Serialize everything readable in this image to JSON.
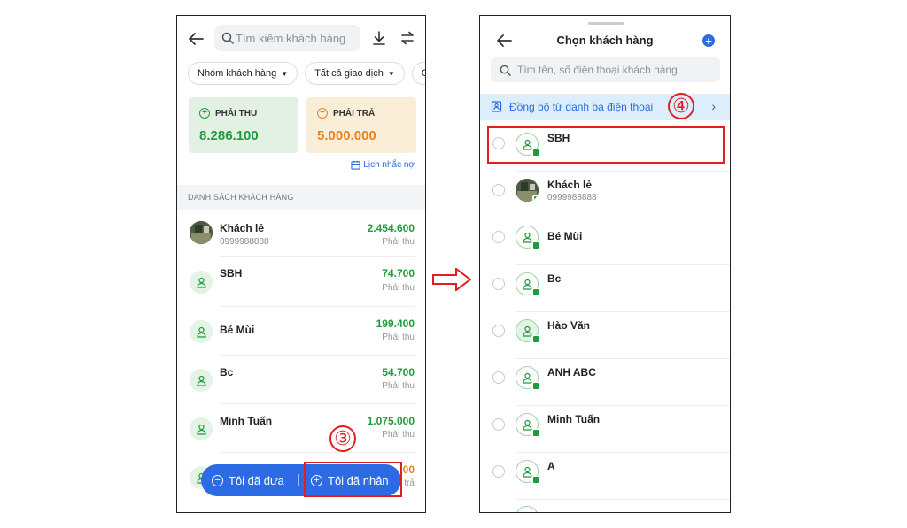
{
  "left": {
    "search_placeholder": "Tìm kiếm khách hàng",
    "filters": [
      "Nhóm khách hàng",
      "Tất cả giao dịch",
      "Gi"
    ],
    "receivable": {
      "label": "PHẢI THU",
      "amount": "8.286.100",
      "icon": "plus-circle-icon",
      "color": "#1e9b3a"
    },
    "payable": {
      "label": "PHẢI TRẢ",
      "amount": "5.000.000",
      "icon": "minus-circle-icon",
      "color": "#e8831c"
    },
    "reminder": "Lịch nhắc nợ",
    "section_title": "DANH SÁCH KHÁCH HÀNG",
    "customers": [
      {
        "name": "Khách lẻ",
        "phone": "0999988888",
        "amount": "2.454.600",
        "status": "Phải thu",
        "avatar": "photo"
      },
      {
        "name": "SBH",
        "phone": "",
        "amount": "74.700",
        "status": "Phải thu",
        "avatar": "person-icon"
      },
      {
        "name": "Bé Mùi",
        "phone": "",
        "amount": "199.400",
        "status": "Phải thu",
        "avatar": "person-icon"
      },
      {
        "name": "Bc",
        "phone": "",
        "amount": "54.700",
        "status": "Phải thu",
        "avatar": "person-icon"
      },
      {
        "name": "Minh Tuấn",
        "phone": "",
        "amount": "1.075.000",
        "status": "Phải thu",
        "avatar": "person-icon"
      },
      {
        "name": "",
        "phone": "",
        "amount": "00",
        "status": "trả",
        "avatar": "person-icon",
        "amount_color": "#e8831c"
      }
    ],
    "actions": {
      "given": "Tôi đã đưa",
      "received": "Tôi đã nhận"
    },
    "step_label": "③"
  },
  "right": {
    "title": "Chọn khách hàng",
    "search_placeholder": "Tìm tên, số điện thoại khách hàng",
    "sync_label": "Đồng bộ từ danh bạ điện thoại",
    "step_label": "④",
    "customers": [
      {
        "name": "SBH",
        "phone": ""
      },
      {
        "name": "Khách lẻ",
        "phone": "0999988888"
      },
      {
        "name": "Bé Mùi",
        "phone": ""
      },
      {
        "name": "Bc",
        "phone": ""
      },
      {
        "name": "Hào Văn",
        "phone": ""
      },
      {
        "name": "ANH ABC",
        "phone": ""
      },
      {
        "name": "Minh Tuấn",
        "phone": ""
      },
      {
        "name": "A",
        "phone": ""
      }
    ]
  },
  "colors": {
    "accent": "#2c6be3",
    "positive": "#1e9b3a",
    "warning": "#e8831c",
    "highlight": "#e02020"
  }
}
